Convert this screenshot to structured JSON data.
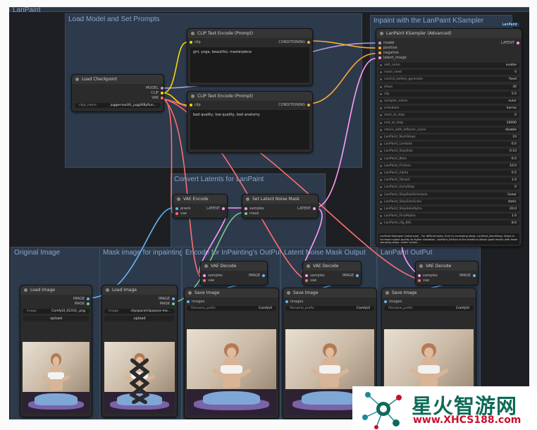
{
  "canvas": {
    "corner_title": "LanPaint",
    "groups": {
      "load_model": "Load Model and Set Prompts",
      "inpaint": "Inpaint with the LanPaint KSampler",
      "convert": "Convert Latents for LanPaint",
      "original_image": "Original Image",
      "mask_image": "Mask image for inpainting",
      "encode": "Encode for InPainting's OutPut",
      "latent_noise": "Latent Noise Mask Output",
      "lanpaint_output": "LanPaint OutPut"
    }
  },
  "load_checkpoint": {
    "title": "Load Checkpoint",
    "outputs": [
      "MODEL",
      "CLIP",
      "VAE"
    ],
    "widget_label": "ckpt_name",
    "widget_value": "juggernautXL_juggXIByRun..."
  },
  "clip_pos": {
    "title": "CLIP Text Encode (Prompt)",
    "input": "clip",
    "output": "CONDITIONING",
    "text": "girl, yoga, beautiful, masterpiece"
  },
  "clip_neg": {
    "title": "CLIP Text Encode (Prompt)",
    "input": "clip",
    "output": "CONDITIONING",
    "text": "bad quality, low quality, bad anatomy"
  },
  "ksampler": {
    "title": "LanPaint KSampler (Advanced)",
    "badge": "LanPaint",
    "inputs": [
      "model",
      "positive",
      "negative",
      "latent_image"
    ],
    "output": "LATENT",
    "params": [
      {
        "label": "add_noise",
        "value": "enable"
      },
      {
        "label": "noise_seed",
        "value": "0"
      },
      {
        "label": "control_before_generate",
        "value": "fixed"
      },
      {
        "label": "steps",
        "value": "30"
      },
      {
        "label": "cfg",
        "value": "5.0"
      },
      {
        "label": "sampler_name",
        "value": "euler"
      },
      {
        "label": "scheduler",
        "value": "karras"
      },
      {
        "label": "start_at_step",
        "value": "0"
      },
      {
        "label": "end_at_step",
        "value": "10000"
      },
      {
        "label": "return_with_leftover_noise",
        "value": "disable"
      },
      {
        "label": "LanPaint_NumSteps",
        "value": "10"
      },
      {
        "label": "LanPaint_Lambda",
        "value": "6.0"
      },
      {
        "label": "LanPaint_StepSize",
        "value": "0.10"
      },
      {
        "label": "LanPaint_Beta",
        "value": "6.0"
      },
      {
        "label": "LanPaint_Friction",
        "value": "10.0"
      },
      {
        "label": "LanPaint_Alpha",
        "value": "0.5"
      },
      {
        "label": "LanPaint_Tamed",
        "value": "1.0"
      },
      {
        "label": "LanPaint_EarlyStop",
        "value": "0"
      },
      {
        "label": "LanPaint_StepSizeSchedule",
        "value": "linear"
      },
      {
        "label": "LanPaint_StepSizeScale",
        "value": "static"
      },
      {
        "label": "LanPaint_StepSizeAlpha",
        "value": "20.0"
      },
      {
        "label": "LanPaint_FinalAlpha",
        "value": "1.0"
      },
      {
        "label": "LanPaint_cfg_BIG",
        "value": "8.0"
      }
    ],
    "info": "LanPaint KSampler (Advanced) - For difficult tasks, first try increasing steps. LanPaint_NumSteps: Steps to increase inpaint quality at higher slowdown. LanPaint_Friction of the model to obtain good results with fewer sampling steps. Lower values ..."
  },
  "vae_encode": {
    "title": "VAE Encode",
    "inputs": [
      "pixels",
      "vae"
    ],
    "output": "LATENT"
  },
  "set_mask": {
    "title": "Set Latent Noise Mask",
    "inputs": [
      "samples",
      "mask"
    ],
    "output": "LATENT"
  },
  "load_image_1": {
    "title": "Load Image",
    "outputs": [
      "IMAGE",
      "MASK"
    ],
    "widget_label": "image",
    "widget_value": "ComfyUI_02333_.png",
    "upload": "upload"
  },
  "load_image_2": {
    "title": "Load Image",
    "outputs": [
      "IMAGE",
      "MASK"
    ],
    "widget_label": "image",
    "widget_value": "clipspace/clipspace-ma...",
    "upload": "upload"
  },
  "vae_decode_1": {
    "title": "VAE Decode",
    "inputs": [
      "samples",
      "vae"
    ],
    "output": "IMAGE"
  },
  "vae_decode_2": {
    "title": "VAE Decode",
    "inputs": [
      "samples",
      "vae"
    ],
    "output": "IMAGE"
  },
  "vae_decode_3": {
    "title": "VAE Decode",
    "inputs": [
      "samples",
      "vae"
    ],
    "output": "IMAGE"
  },
  "save_1": {
    "title": "Save Image",
    "input": "images",
    "widget_label": "filename_prefix",
    "widget_value": "ComfyUI"
  },
  "save_2": {
    "title": "Save Image",
    "input": "images",
    "widget_label": "filename_prefix",
    "widget_value": "ComfyUI"
  },
  "save_3": {
    "title": "Save Image",
    "input": "images",
    "widget_label": "filename_prefix",
    "widget_value": "ComfyUI"
  },
  "watermark": {
    "brand": "星火智游网",
    "url": "www.XHCS188.com"
  },
  "colors": {
    "canvas": "#1e1f22",
    "group": "#2c3a4c",
    "node": "#2b2b2b",
    "model_wire": "#b39ddb",
    "clip_wire": "#ffd500",
    "vae_wire": "#ff6e6e",
    "conditioning_wire": "#ffa931",
    "latent_wire": "#ff9cf9",
    "image_wire": "#64b5f6",
    "mask_wire": "#81c784",
    "watermark_green": "#0d6b57",
    "watermark_red": "#c8102e"
  }
}
